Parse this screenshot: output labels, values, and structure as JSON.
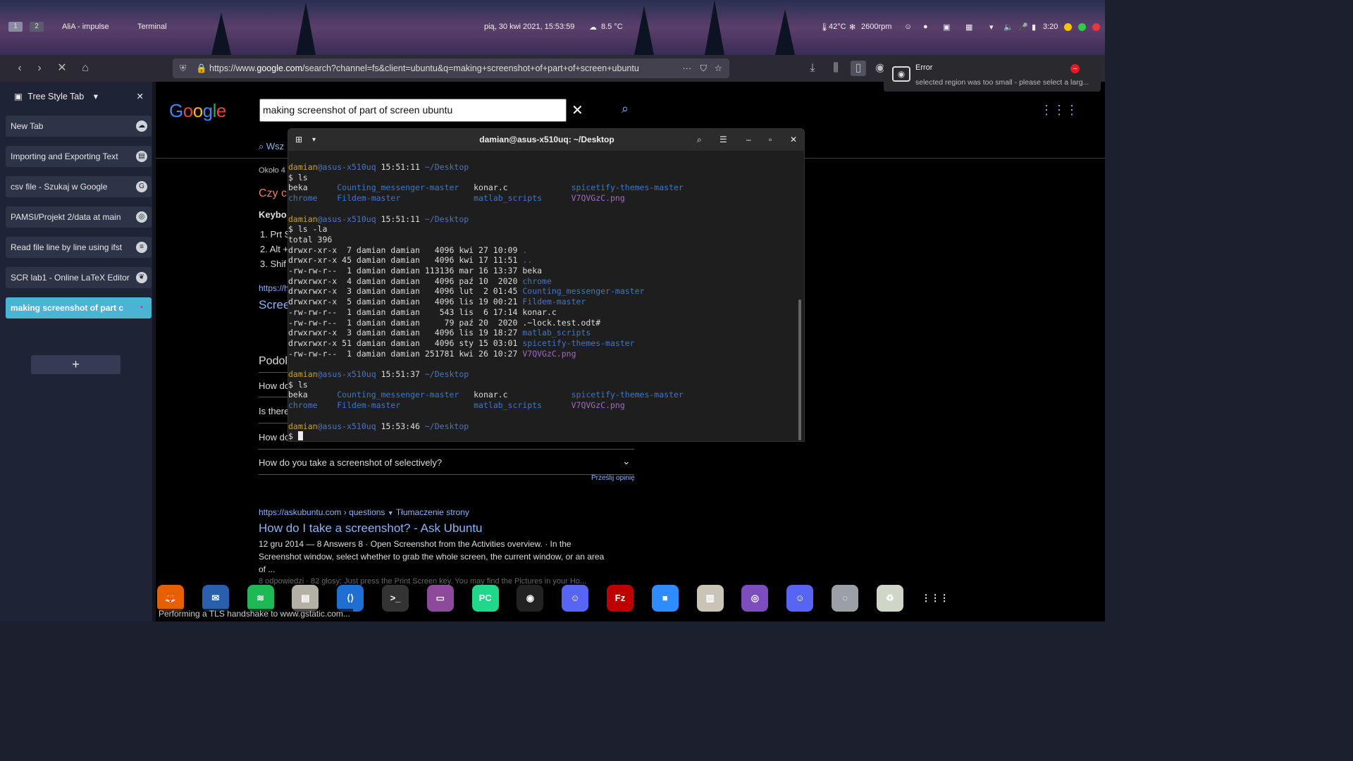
{
  "topbar": {
    "workspaces": [
      "1",
      "2"
    ],
    "window_items": [
      "AliA - impulse",
      "Terminal"
    ],
    "datetime": "pią, 30 kwi 2021, 15:53:59",
    "weather": "8.5 °C",
    "temp": "42°C",
    "fan": "2600rpm",
    "battery_time": "3:20"
  },
  "browser": {
    "url_prefix": "https://www.",
    "url_domain": "google.com",
    "url_rest": "/search?channel=fs&client=ubuntu&q=making+screenshot+of+part+of+screen+ubuntu",
    "sidebar_title": "Tree Style Tab",
    "tabs": [
      {
        "label": "New Tab",
        "icon": "ghost-icon"
      },
      {
        "label": "Importing and Exporting Text",
        "icon": "document-icon"
      },
      {
        "label": "csv file - Szukaj w Google",
        "icon": "google-icon"
      },
      {
        "label": "PAMSI/Projekt 2/data at main",
        "icon": "github-icon"
      },
      {
        "label": "Read file line by line using ifst",
        "icon": "stackoverflow-icon"
      },
      {
        "label": "SCR lab1 - Online LaTeX Editor",
        "icon": "overleaf-icon"
      },
      {
        "label": "making screenshot of part c",
        "icon": "loading-icon"
      }
    ],
    "add_tab": "+",
    "status": "Performing a TLS handshake to www.gstatic.com..."
  },
  "google": {
    "logo": "Google",
    "query": "making screenshot of part of screen ubuntu",
    "tab_all": "Wsz",
    "result_count": "Około 4",
    "snippet_question": "Czy cl",
    "keyboard_label": "Keybo",
    "list": [
      "1. Prt S",
      "2. Alt +",
      "3. Shif"
    ],
    "result_url_short": "https://h",
    "result_title_short": "Scree",
    "related_heading": "Podol",
    "related_questions": [
      "How do",
      "Is there",
      "How do",
      "How do you take a screenshot of selectively?"
    ],
    "feedback": "Prześlij opinię",
    "r2_url": "https://askubuntu.com › questions",
    "r2_translate": "Tłumaczenie strony",
    "r2_title": "How do I take a screenshot? - Ask Ubuntu",
    "r2_snippet1": "12 gru 2014 — 8 Answers 8 · Open Screenshot from the Activities overview. · In the",
    "r2_snippet2": "Screenshot window, select whether to grab the whole screen, the current window, or an area",
    "r2_snippet3": "of ...",
    "r2_more": "8 odpowiedzi · 82 głosy: Just press the Print Screen key. You may find the Pictures in your Ho..."
  },
  "terminal": {
    "title": "damian@asus-x510uq: ~/Desktop",
    "lines": [
      {
        "user": "damian",
        "host": "@asus-x510uq",
        "time": " 15:51:11",
        "dir": " ~/Desktop"
      },
      {
        "text": "$ ls"
      },
      {
        "cols": [
          [
            "beka",
            ""
          ],
          [
            "Counting_messenger-master",
            "b"
          ],
          [
            "konar.c",
            ""
          ],
          [
            "spicetify-themes-master",
            "b"
          ]
        ]
      },
      {
        "cols": [
          [
            "chrome",
            "b"
          ],
          [
            "Fildem-master",
            "b"
          ],
          [
            "matlab_scripts",
            "b"
          ],
          [
            "V7QVGzC.png",
            "p"
          ]
        ]
      },
      {
        "text": ""
      },
      {
        "user": "damian",
        "host": "@asus-x510uq",
        "time": " 15:51:11",
        "dir": " ~/Desktop"
      },
      {
        "text": "$ ls -la"
      },
      {
        "text": "total 396"
      },
      {
        "perm": "drwxr-xr-x  7 damian damian   4096 kwi 27 10:09 ",
        "name": ".",
        "c": "b"
      },
      {
        "perm": "drwxr-xr-x 45 damian damian   4096 kwi 17 11:51 ",
        "name": "..",
        "c": "b"
      },
      {
        "perm": "-rw-rw-r--  1 damian damian 113136 mar 16 13:37 ",
        "name": "beka",
        "c": ""
      },
      {
        "perm": "drwxrwxr-x  4 damian damian   4096 paź 10  2020 ",
        "name": "chrome",
        "c": "b"
      },
      {
        "perm": "drwxrwxr-x  3 damian damian   4096 lut  2 01:45 ",
        "name": "Counting_messenger-master",
        "c": "b"
      },
      {
        "perm": "drwxrwxr-x  5 damian damian   4096 lis 19 00:21 ",
        "name": "Fildem-master",
        "c": "b"
      },
      {
        "perm": "-rw-rw-r--  1 damian damian    543 lis  6 17:14 ",
        "name": "konar.c",
        "c": ""
      },
      {
        "perm": "-rw-rw-r--  1 damian damian     79 paź 20  2020 ",
        "name": ".~lock.test.odt#",
        "c": ""
      },
      {
        "perm": "drwxrwxr-x  3 damian damian   4096 lis 19 18:27 ",
        "name": "matlab_scripts",
        "c": "b"
      },
      {
        "perm": "drwxrwxr-x 51 damian damian   4096 sty 15 03:01 ",
        "name": "spicetify-themes-master",
        "c": "b"
      },
      {
        "perm": "-rw-rw-r--  1 damian damian 251781 kwi 26 10:27 ",
        "name": "V7QVGzC.png",
        "c": "p"
      },
      {
        "text": ""
      },
      {
        "user": "damian",
        "host": "@asus-x510uq",
        "time": " 15:51:37",
        "dir": " ~/Desktop"
      },
      {
        "text": "$ ls"
      },
      {
        "cols": [
          [
            "beka",
            ""
          ],
          [
            "Counting_messenger-master",
            "b"
          ],
          [
            "konar.c",
            ""
          ],
          [
            "spicetify-themes-master",
            "b"
          ]
        ]
      },
      {
        "cols": [
          [
            "chrome",
            "b"
          ],
          [
            "Fildem-master",
            "b"
          ],
          [
            "matlab_scripts",
            "b"
          ],
          [
            "V7QVGzC.png",
            "p"
          ]
        ]
      },
      {
        "text": ""
      },
      {
        "user": "damian",
        "host": "@asus-x510uq",
        "time": " 15:53:46",
        "dir": " ~/Desktop"
      },
      {
        "text": "$ ",
        "cursor": true
      }
    ]
  },
  "notification": {
    "title": "Error",
    "message": "selected region was too small - please select a larg..."
  },
  "dock": [
    {
      "name": "firefox",
      "color": "#e66000",
      "glyph": "🦊"
    },
    {
      "name": "thunderbird",
      "color": "#2a5fae",
      "glyph": "✉"
    },
    {
      "name": "spotify",
      "color": "#1db954",
      "glyph": "≋"
    },
    {
      "name": "files",
      "color": "#b5b0a5",
      "glyph": "▤"
    },
    {
      "name": "vscode",
      "color": "#1e6fd1",
      "glyph": "⟨⟩"
    },
    {
      "name": "terminal",
      "color": "#333333",
      "glyph": ">_"
    },
    {
      "name": "screenshot",
      "color": "#8d4a9a",
      "glyph": "▭"
    },
    {
      "name": "pycharm",
      "color": "#21d789",
      "glyph": "PC"
    },
    {
      "name": "obs",
      "color": "#222222",
      "glyph": "◉"
    },
    {
      "name": "discord",
      "color": "#5865f2",
      "glyph": "☺"
    },
    {
      "name": "filezilla",
      "color": "#bf0000",
      "glyph": "Fz"
    },
    {
      "name": "zoom",
      "color": "#2d8cff",
      "glyph": "■"
    },
    {
      "name": "archive",
      "color": "#c9c4b6",
      "glyph": "▥"
    },
    {
      "name": "github",
      "color": "#7d4dbe",
      "glyph": "◎"
    },
    {
      "name": "discord2",
      "color": "#5865f2",
      "glyph": "☺"
    },
    {
      "name": "disks",
      "color": "#9aa0a6",
      "glyph": "◌"
    },
    {
      "name": "trash",
      "color": "#cfd6c8",
      "glyph": "♻"
    },
    {
      "name": "apps",
      "color": "transparent",
      "glyph": "⋮⋮⋮"
    }
  ]
}
